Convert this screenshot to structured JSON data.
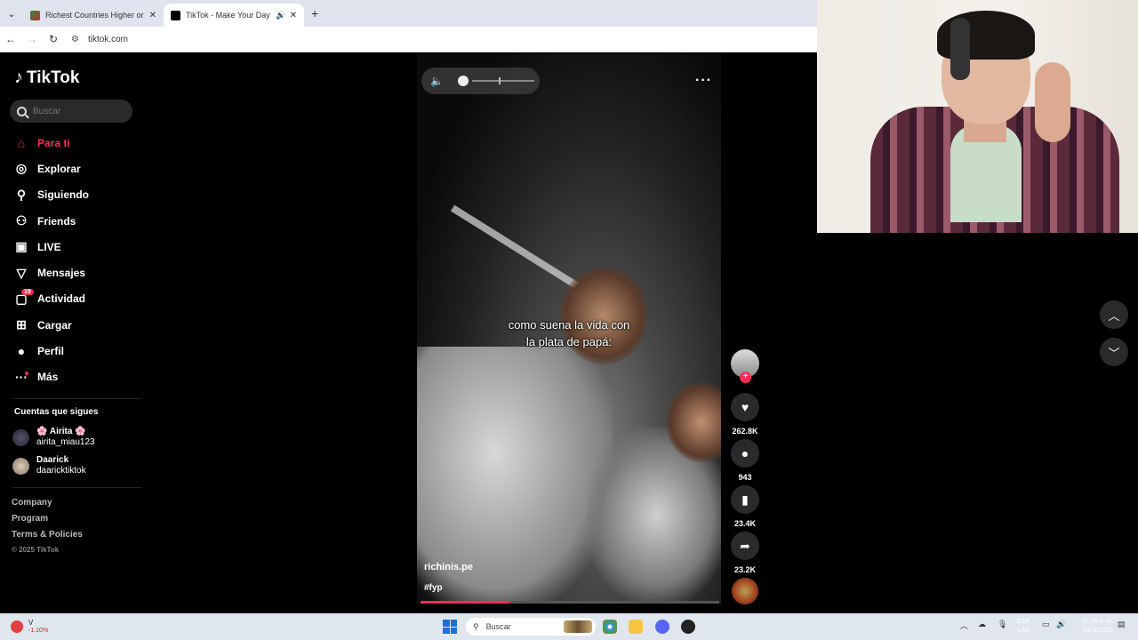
{
  "browser": {
    "tabs": [
      {
        "title": "Richest Countries Higher or Lo",
        "active": false
      },
      {
        "title": "TikTok - Make Your Day",
        "active": true
      }
    ],
    "url": "tiktok.com"
  },
  "sidebar": {
    "logo": "TikTok",
    "search_placeholder": "Buscar",
    "nav": [
      {
        "label": "Para ti",
        "icon": "home-icon"
      },
      {
        "label": "Explorar",
        "icon": "compass-icon"
      },
      {
        "label": "Siguiendo",
        "icon": "user-follow-icon"
      },
      {
        "label": "Friends",
        "icon": "friends-icon"
      },
      {
        "label": "LIVE",
        "icon": "live-icon"
      },
      {
        "label": "Mensajes",
        "icon": "send-icon"
      },
      {
        "label": "Actividad",
        "icon": "activity-icon",
        "badge": "19"
      },
      {
        "label": "Cargar",
        "icon": "upload-icon"
      },
      {
        "label": "Perfil",
        "icon": "avatar-icon"
      },
      {
        "label": "Más",
        "icon": "more-icon"
      }
    ],
    "following_title": "Cuentas que sigues",
    "following": [
      {
        "name": "🌸 Airita 🌸",
        "handle": "airita_miau123"
      },
      {
        "name": "Daarick",
        "handle": "daaricktiktok"
      }
    ],
    "footer": [
      "Company",
      "Program",
      "Terms & Policies"
    ],
    "copyright": "© 2025 TikTok"
  },
  "video": {
    "caption_line1": "como suena la vida con",
    "caption_line2": "la plata de papá:",
    "author": "richinis.pe",
    "tags": "#fyp",
    "progress": 0.3
  },
  "actions": {
    "likes": "262.8K",
    "comments": "943",
    "saves": "23.4K",
    "shares": "23.2K"
  },
  "taskbar": {
    "weather_value": "V",
    "weather_change": "-1.10%",
    "search_placeholder": "Buscar",
    "lang1": "ESP",
    "lang2": "LAA",
    "time": "07:36 p. m.",
    "date": "10/11/2025"
  },
  "colors": {
    "accent": "#fe2c55"
  }
}
